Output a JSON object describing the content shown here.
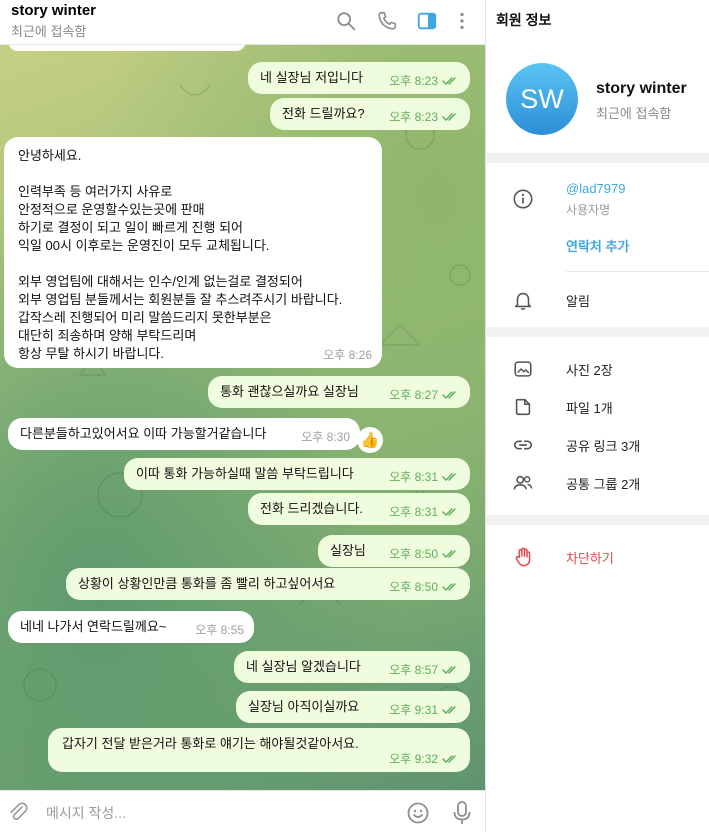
{
  "chat": {
    "title": "story winter",
    "status": "최근에 접속함",
    "messages": [
      {
        "dir": "out",
        "text": "네 실장님 저입니다",
        "time": "오후 8:23"
      },
      {
        "dir": "out",
        "text": "전화 드릴까요?",
        "time": "오후 8:23"
      },
      {
        "dir": "in",
        "text": "안녕하세요.\n\n인력부족 등 여러가지 사유로\n안정적으로 운영할수있는곳에 판매\n하기로 결정이 되고 일이 빠르게 진행 되어\n익일 00시 이후로는 운영진이 모두 교체됩니다.\n\n외부 영업팀에 대해서는 인수/인계 없는걸로 결정되어\n외부 영업팀 분들께서는 회원분들 잘 추스려주시기 바랍니다.\n갑작스레 진행되어 미리 말씀드리지 못한부분은\n대단히 죄송하며 양해 부탁드리며\n항상 무탈 하시기 바랍니다.",
        "time": "오후 8:26"
      },
      {
        "dir": "out",
        "text": "통화 괜찮으실까요 실장님",
        "time": "오후 8:27"
      },
      {
        "dir": "in",
        "text": "다른분들하고있어서요 이따 가능할거같습니다",
        "time": "오후 8:30",
        "reaction": "👍"
      },
      {
        "dir": "out",
        "text": "이따 통화 가능하실때 말씀 부탁드립니다",
        "time": "오후 8:31"
      },
      {
        "dir": "out",
        "text": "전화 드리겠습니다.",
        "time": "오후 8:31"
      },
      {
        "dir": "out",
        "text": "실장님",
        "time": "오후 8:50"
      },
      {
        "dir": "out",
        "text": "상황이 상황인만큼 통화를 좀 빨리 하고싶어서요",
        "time": "오후 8:50"
      },
      {
        "dir": "in",
        "text": "네네 나가서 연락드릴께요~",
        "time": "오후 8:55"
      },
      {
        "dir": "out",
        "text": "네 실장님 알겠습니다",
        "time": "오후 8:57"
      },
      {
        "dir": "out",
        "text": "실장님 아직이실까요",
        "time": "오후 9:31"
      },
      {
        "dir": "out",
        "text": "갑자기 전달 받은거라 통화로 얘기는 해야될것같아서요.",
        "time": "오후 9:32"
      }
    ],
    "composer_placeholder": "메시지 작성..."
  },
  "icons": {
    "search": "search-icon",
    "call": "phone-icon",
    "sidebar": "sidebar-toggle-icon",
    "more": "more-vertical-icon",
    "attach": "paperclip-icon",
    "emoji": "emoji-icon",
    "mic": "microphone-icon"
  },
  "profile": {
    "panel_title": "회원 정보",
    "avatar_initials": "SW",
    "name": "story winter",
    "status": "최근에 접속함",
    "username": "@lad7979",
    "username_label": "사용자명",
    "add_contact": "연락처 추가",
    "notifications": "알림",
    "media": [
      {
        "icon": "photo-icon",
        "label": "사진 2장"
      },
      {
        "icon": "file-icon",
        "label": "파일 1개"
      },
      {
        "icon": "link-icon",
        "label": "공유 링크 3개"
      },
      {
        "icon": "group-icon",
        "label": "공통 그룹 2개"
      }
    ],
    "block": "차단하기"
  },
  "colors": {
    "accent": "#40a7e3",
    "outgoing_bubble": "#effdde",
    "danger": "#e0474b",
    "avatar_gradient_top": "#5bc4f3",
    "avatar_gradient_bottom": "#2c8ed6"
  }
}
